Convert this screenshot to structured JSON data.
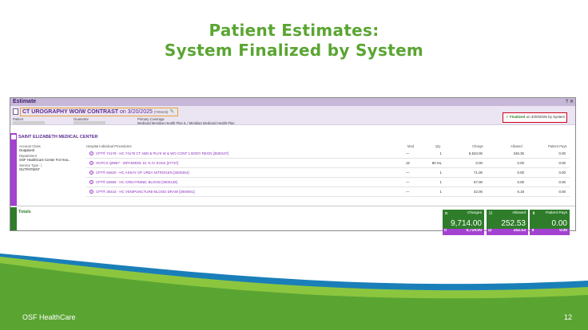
{
  "slide": {
    "title_line1": "Patient Estimates:",
    "title_line2": "System Finalized by System",
    "footer_org": "OSF HealthCare",
    "page_number": "12"
  },
  "window": {
    "header": "Estimate",
    "controls": "? ✕"
  },
  "estimate": {
    "name": "CT UROGRAPHY WO/W CONTRAST",
    "date_text": "on 3/20/2025",
    "id_text": "[765545]",
    "patient_label": "Patient",
    "guarantor_label": "Guarantor",
    "coverage_label": "Primary Coverage",
    "coverage_value": "Medicaid Meridian Health Plan IL / Meridian Medicaid Health Plan",
    "status_finalized": "Finalized",
    "status_rest": "on 3/20/2025 by System"
  },
  "hospital": {
    "name": "SAINT ELIZABETH MEDICAL CENTER",
    "account_class_label": "Account Class",
    "account_class_value": "Outpatient",
    "department_label": "Department",
    "department_value": "OSF HealthCare Center For Hea...",
    "service_type_label": "Service Type",
    "service_type_value": "OUTPATIENT",
    "columns": {
      "procedures": "Hospital Individual Procedures",
      "mod": "Mod",
      "qty": "Qty",
      "charge": "Charge",
      "allowed": "Allowed",
      "patient_pays": "Patient Pays"
    },
    "procedures": [
      {
        "desc": "CPT® 74178 - HC 74178 CT ABD & PLVS W & WO CONT 1 BODY REGN [3500107]",
        "mod": "—",
        "qty": "1",
        "charge": "9,534.00",
        "allowed": "246.35",
        "patient": "0.00"
      },
      {
        "desc": "HCPCS Q9967 - IOPAMIDOL 61 % IV SOLN [27737]",
        "mod": "JZ",
        "qty": "80 mL",
        "charge": "0.00",
        "allowed": "0.00",
        "patient": "0.00"
      },
      {
        "desc": "CPT® 84520 - HC ASSAY OF UREA NITROGEN [3000364]",
        "mod": "—",
        "qty": "1",
        "charge": "71.00",
        "allowed": "0.00",
        "patient": "0.00"
      },
      {
        "desc": "CPT® 82565 - HC CREATININE; BLOOD [3000139]",
        "mod": "—",
        "qty": "1",
        "charge": "67.00",
        "allowed": "0.00",
        "patient": "0.00"
      },
      {
        "desc": "CPT® 36415 - HC VENIPUNCTURE-BLOOD DRAW [3000001]",
        "mod": "—",
        "qty": "1",
        "charge": "42.00",
        "allowed": "6.18",
        "patient": "0.00"
      }
    ],
    "subtotals": {
      "charge": "9,714.00",
      "allowed": "252.53",
      "patient": "0.00"
    }
  },
  "totals": {
    "label": "Totals",
    "charges_label": "Charges",
    "charges_value": "9,714.00",
    "allowed_label": "Allowed",
    "allowed_value": "252.53",
    "patient_label": "Patient Pays",
    "patient_value": "0.00"
  },
  "colors": {
    "title_green": "#5aa532",
    "purple": "#a341d0",
    "dark_green": "#2f7d2a",
    "status_border": "#d0021b"
  }
}
